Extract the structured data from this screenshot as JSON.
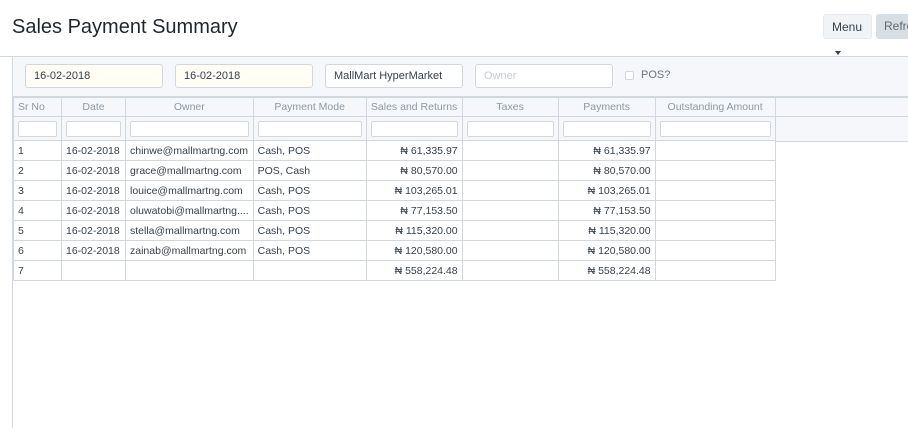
{
  "header": {
    "title": "Sales Payment Summary",
    "menu_label": "Menu",
    "refresh_label": "Refre"
  },
  "filters": {
    "from_date": "16-02-2018",
    "to_date": "16-02-2018",
    "company": "MallMart HyperMarket",
    "owner_placeholder": "Owner",
    "pos_label": "POS?"
  },
  "table": {
    "columns": [
      "Sr No",
      "Date",
      "Owner",
      "Payment Mode",
      "Sales and Returns",
      "Taxes",
      "Payments",
      "Outstanding Amount"
    ],
    "rows": [
      [
        "1",
        "16-02-2018",
        "chinwe@mallmartng.com",
        "Cash, POS",
        "₦ 61,335.97",
        "",
        "₦ 61,335.97",
        ""
      ],
      [
        "2",
        "16-02-2018",
        "grace@mallmartng.com",
        "POS, Cash",
        "₦ 80,570.00",
        "",
        "₦ 80,570.00",
        ""
      ],
      [
        "3",
        "16-02-2018",
        "louice@mallmartng.com",
        "Cash, POS",
        "₦ 103,265.01",
        "",
        "₦ 103,265.01",
        ""
      ],
      [
        "4",
        "16-02-2018",
        "oluwatobi@mallmartng....",
        "Cash, POS",
        "₦ 77,153.50",
        "",
        "₦ 77,153.50",
        ""
      ],
      [
        "5",
        "16-02-2018",
        "stella@mallmartng.com",
        "Cash, POS",
        "₦ 115,320.00",
        "",
        "₦ 115,320.00",
        ""
      ],
      [
        "6",
        "16-02-2018",
        "zainab@mallmartng.com",
        "Cash, POS",
        "₦ 120,580.00",
        "",
        "₦ 120,580.00",
        ""
      ],
      [
        "7",
        "",
        "",
        "",
        "₦ 558,224.48",
        "",
        "₦ 558,224.48",
        ""
      ]
    ]
  }
}
